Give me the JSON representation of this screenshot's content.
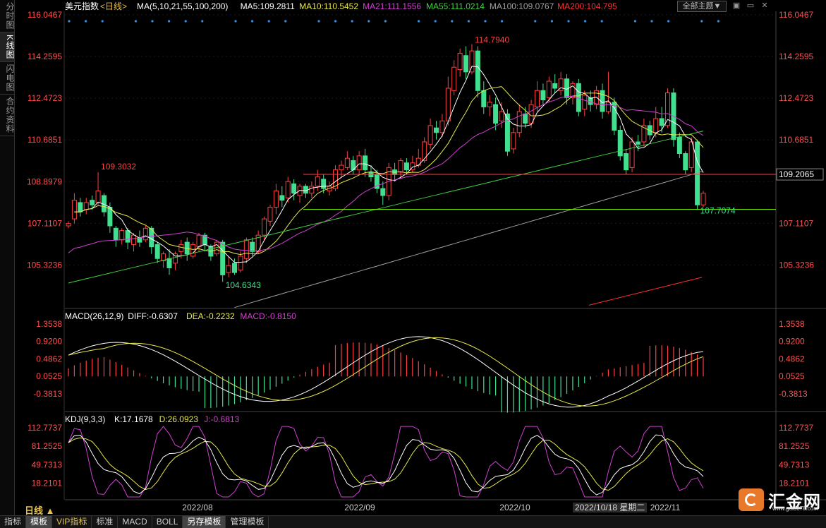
{
  "sidebar": {
    "tabs": [
      {
        "label": "分时图",
        "active": false
      },
      {
        "label": "K线图",
        "active": true
      },
      {
        "label": "闪电图",
        "active": false
      },
      {
        "label": "合约资料",
        "active": false
      }
    ]
  },
  "header": {
    "title": "美元指数",
    "period": "<日线>",
    "ma_items": [
      {
        "text": "MA(5,10,21,55,100,200)",
        "color": "#ffffff"
      },
      {
        "text": "MA5:109.2811",
        "color": "#ffffff"
      },
      {
        "text": "MA10:110.5452",
        "color": "#e8e84a"
      },
      {
        "text": "MA21:111.1556",
        "color": "#d040d0"
      },
      {
        "text": "MA55:111.0214",
        "color": "#40d040"
      },
      {
        "text": "MA100:109.0767",
        "color": "#a0a0a0"
      },
      {
        "text": "MA200:104.795",
        "color": "#ff3030"
      }
    ],
    "theme_button": "全部主题▼"
  },
  "main_panel": {
    "axis_labels": [
      "116.0467",
      "114.2595",
      "112.4723",
      "110.6851",
      "108.8979",
      "107.1107",
      "105.3236"
    ],
    "right_axis_labels": [
      "116.0467",
      "114.2595",
      "112.4723",
      "110.6851",
      "109.2065",
      "107.1107",
      "105.3236"
    ],
    "annotations": [
      "109.3032",
      "114.7940",
      "104.6343",
      "107.7074"
    ]
  },
  "macd_panel": {
    "legend": [
      {
        "text": "MACD(26,12,9)",
        "color": "#ffffff"
      },
      {
        "text": "DIFF:-0.6307",
        "color": "#ffffff"
      },
      {
        "text": "DEA:-0.2232",
        "color": "#e8e84a"
      },
      {
        "text": "MACD:-0.8150",
        "color": "#d040d0"
      }
    ],
    "axis_labels": [
      "1.3538",
      "0.9200",
      "0.4862",
      "0.0525",
      "-0.3813"
    ]
  },
  "kdj_panel": {
    "legend": [
      {
        "text": "KDJ(9,3,3)",
        "color": "#ffffff"
      },
      {
        "text": "K:17.1678",
        "color": "#ffffff"
      },
      {
        "text": "D:26.0923",
        "color": "#e8e84a"
      },
      {
        "text": "J:-0.6813",
        "color": "#d040d0"
      }
    ],
    "axis_labels": [
      "112.7737",
      "81.2525",
      "49.7313",
      "18.2101"
    ]
  },
  "x_axis": {
    "labels": [
      "2022/08",
      "2022/09",
      "2022/10",
      "2022/11"
    ]
  },
  "cursor_date": "2022/10/18 星期二",
  "period_label": "日线 ▲",
  "bottom_tabs": [
    {
      "label": "指标",
      "active": false,
      "vip": false
    },
    {
      "label": "模板",
      "active": true,
      "vip": false
    },
    {
      "label": "VIP指标",
      "active": false,
      "vip": true
    },
    {
      "label": "标准",
      "active": false,
      "vip": false
    },
    {
      "label": "MACD",
      "active": false,
      "vip": false
    },
    {
      "label": "BOLL",
      "active": false,
      "vip": false
    },
    {
      "label": "另存模板",
      "active": true,
      "vip": false
    },
    {
      "label": "管理模板",
      "active": false,
      "vip": false
    }
  ],
  "logo": {
    "name": "汇金网",
    "url": "www.gold678.com"
  },
  "colors": {
    "up": "#ff4040",
    "down": "#40e090",
    "ma5": "#ffffff",
    "ma10": "#e8e84a",
    "ma21": "#d040d0",
    "ma55": "#40d040",
    "ma100": "#a0a0a0",
    "ma200": "#ff3030",
    "support": "#80ff00",
    "resistance": "#ff4040"
  }
}
